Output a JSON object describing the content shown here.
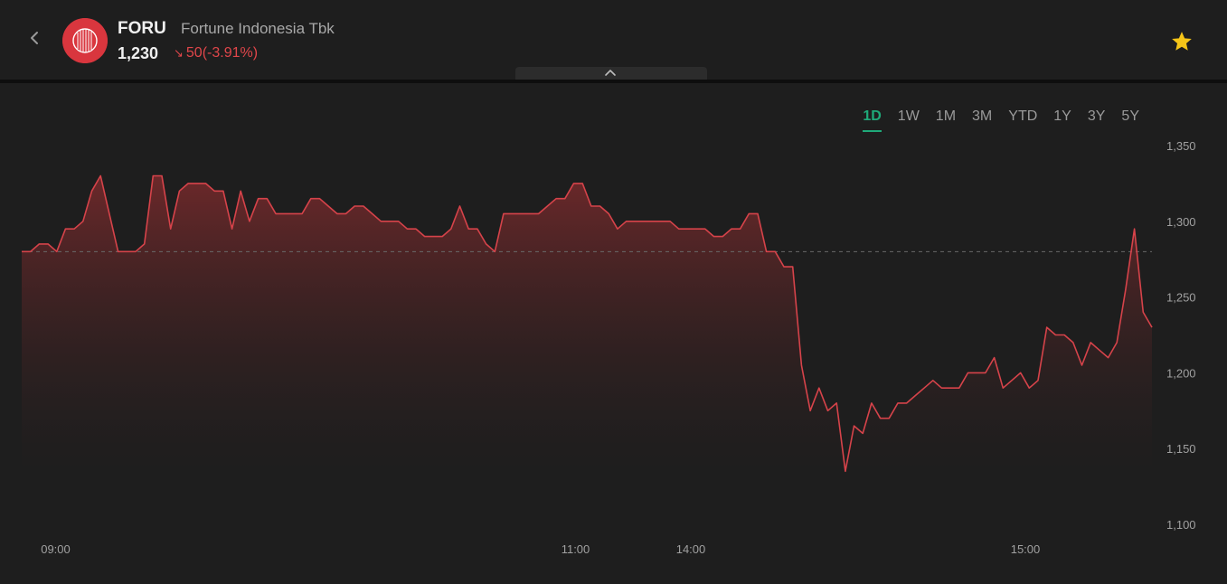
{
  "header": {
    "ticker": "FORU",
    "company_name": "Fortune Indonesia Tbk",
    "price": "1,230",
    "change_arrow": "↘",
    "change_value": "50",
    "change_percent": "(-3.91%)",
    "back_icon": "chevron-left-icon",
    "favorite_icon": "star-icon",
    "collapse_icon": "chevron-up-icon"
  },
  "colors": {
    "accent_active": "#1fa979",
    "negative": "#e0464a",
    "line": "#d6434a",
    "star": "#f5c518",
    "logo": "#d9363e"
  },
  "ranges": [
    "1D",
    "1W",
    "1M",
    "3M",
    "YTD",
    "1Y",
    "3Y",
    "5Y"
  ],
  "active_range": "1D",
  "chart_data": {
    "type": "area",
    "ylim": [
      1100,
      1350
    ],
    "yticks": [
      1350,
      1300,
      1250,
      1200,
      1150,
      1100
    ],
    "ytick_labels": [
      "1,350",
      "1,300",
      "1,250",
      "1,200",
      "1,150",
      "1,100"
    ],
    "xtick_labels": [
      "09:00",
      "11:00",
      "14:00",
      "15:00"
    ],
    "previous_close": 1280,
    "grid": false,
    "values": [
      1280,
      1280,
      1285,
      1285,
      1280,
      1295,
      1295,
      1300,
      1320,
      1330,
      1305,
      1280,
      1280,
      1280,
      1285,
      1330,
      1330,
      1295,
      1320,
      1325,
      1325,
      1325,
      1320,
      1320,
      1295,
      1320,
      1300,
      1315,
      1315,
      1305,
      1305,
      1305,
      1305,
      1315,
      1315,
      1310,
      1305,
      1305,
      1310,
      1310,
      1305,
      1300,
      1300,
      1300,
      1295,
      1295,
      1290,
      1290,
      1290,
      1295,
      1310,
      1295,
      1295,
      1285,
      1280,
      1305,
      1305,
      1305,
      1305,
      1305,
      1310,
      1315,
      1315,
      1325,
      1325,
      1310,
      1310,
      1305,
      1295,
      1300,
      1300,
      1300,
      1300,
      1300,
      1300,
      1295,
      1295,
      1295,
      1295,
      1290,
      1290,
      1295,
      1295,
      1305,
      1305,
      1280,
      1280,
      1270,
      1270,
      1205,
      1175,
      1190,
      1175,
      1180,
      1135,
      1165,
      1160,
      1180,
      1170,
      1170,
      1180,
      1180,
      1185,
      1190,
      1195,
      1190,
      1190,
      1190,
      1200,
      1200,
      1200,
      1210,
      1190,
      1195,
      1200,
      1190,
      1195,
      1230,
      1225,
      1225,
      1220,
      1205,
      1220,
      1215,
      1210,
      1220,
      1255,
      1295,
      1240,
      1230
    ]
  }
}
